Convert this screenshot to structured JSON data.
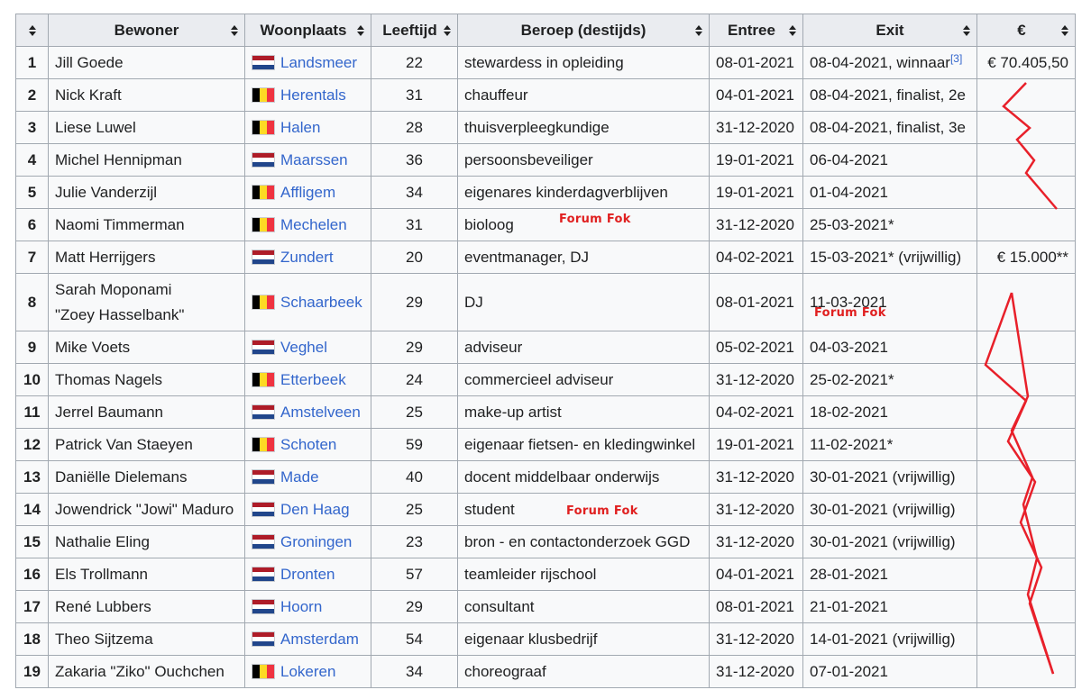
{
  "table": {
    "headers": {
      "num": "",
      "bewoner": "Bewoner",
      "woonplaats": "Woonplaats",
      "leeftijd": "Leeftijd",
      "beroep": "Beroep (destijds)",
      "entree": "Entree",
      "exit": "Exit",
      "prize": "€"
    },
    "rows": [
      {
        "num": "1",
        "name": "Jill Goede",
        "flag": "nl",
        "city": "Landsmeer",
        "age": "22",
        "job": "stewardess in opleiding",
        "entree": "08-01-2021",
        "exit": "08-04-2021, winnaar",
        "ref": "[3]",
        "prize": "€ 70.405,50"
      },
      {
        "num": "2",
        "name": "Nick Kraft",
        "flag": "be",
        "city": "Herentals",
        "age": "31",
        "job": "chauffeur",
        "entree": "04-01-2021",
        "exit": "08-04-2021, finalist, 2e",
        "prize": ""
      },
      {
        "num": "3",
        "name": "Liese Luwel",
        "flag": "be",
        "city": "Halen",
        "age": "28",
        "job": "thuisverpleegkundige",
        "entree": "31-12-2020",
        "exit": "08-04-2021, finalist, 3e",
        "prize": ""
      },
      {
        "num": "4",
        "name": "Michel Hennipman",
        "flag": "nl",
        "city": "Maarssen",
        "age": "36",
        "job": "persoonsbeveiliger",
        "entree": "19-01-2021",
        "exit": "06-04-2021",
        "prize": ""
      },
      {
        "num": "5",
        "name": "Julie Vanderzijl",
        "flag": "be",
        "city": "Affligem",
        "age": "34",
        "job": "eigenares kinderdagverblijven",
        "entree": "19-01-2021",
        "exit": "01-04-2021",
        "prize": ""
      },
      {
        "num": "6",
        "name": "Naomi Timmerman",
        "flag": "be",
        "city": "Mechelen",
        "age": "31",
        "job": "bioloog",
        "entree": "31-12-2020",
        "exit": "25-03-2021*",
        "prize": ""
      },
      {
        "num": "7",
        "name": "Matt Herrijgers",
        "flag": "nl",
        "city": "Zundert",
        "age": "20",
        "job": "eventmanager, DJ",
        "entree": "04-02-2021",
        "exit": "15-03-2021* (vrijwillig)",
        "prize": "€ 15.000**"
      },
      {
        "num": "8",
        "name": "Sarah Moponami",
        "name2": "\"Zoey Hasselbank\"",
        "flag": "be",
        "city": "Schaarbeek",
        "age": "29",
        "job": "DJ",
        "entree": "08-01-2021",
        "exit": "11-03-2021",
        "prize": ""
      },
      {
        "num": "9",
        "name": "Mike Voets",
        "flag": "nl",
        "city": "Veghel",
        "age": "29",
        "job": "adviseur",
        "entree": "05-02-2021",
        "exit": "04-03-2021",
        "prize": ""
      },
      {
        "num": "10",
        "name": "Thomas Nagels",
        "flag": "be",
        "city": "Etterbeek",
        "age": "24",
        "job": "commercieel adviseur",
        "entree": "31-12-2020",
        "exit": "25-02-2021*",
        "prize": ""
      },
      {
        "num": "11",
        "name": "Jerrel Baumann",
        "flag": "nl",
        "city": "Amstelveen",
        "age": "25",
        "job": "make-up artist",
        "entree": "04-02-2021",
        "exit": "18-02-2021",
        "prize": ""
      },
      {
        "num": "12",
        "name": "Patrick Van Staeyen",
        "flag": "be",
        "city": "Schoten",
        "age": "59",
        "job": "eigenaar fietsen- en kledingwinkel",
        "entree": "19-01-2021",
        "exit": "11-02-2021*",
        "prize": ""
      },
      {
        "num": "13",
        "name": "Daniëlle Dielemans",
        "flag": "nl",
        "city": "Made",
        "age": "40",
        "job": "docent middelbaar onderwijs",
        "entree": "31-12-2020",
        "exit": "30-01-2021 (vrijwillig)",
        "prize": ""
      },
      {
        "num": "14",
        "name": "Jowendrick \"Jowi\" Maduro",
        "flag": "nl",
        "city": "Den Haag",
        "age": "25",
        "job": "student",
        "entree": "31-12-2020",
        "exit": "30-01-2021 (vrijwillig)",
        "prize": ""
      },
      {
        "num": "15",
        "name": "Nathalie Eling",
        "flag": "nl",
        "city": "Groningen",
        "age": "23",
        "job": "bron - en contactonderzoek GGD",
        "entree": "31-12-2020",
        "exit": "30-01-2021 (vrijwillig)",
        "prize": ""
      },
      {
        "num": "16",
        "name": "Els Trollmann",
        "flag": "nl",
        "city": "Dronten",
        "age": "57",
        "job": "teamleider rijschool",
        "entree": "04-01-2021",
        "exit": "28-01-2021",
        "prize": ""
      },
      {
        "num": "17",
        "name": "René Lubbers",
        "flag": "nl",
        "city": "Hoorn",
        "age": "29",
        "job": "consultant",
        "entree": "08-01-2021",
        "exit": "21-01-2021",
        "prize": ""
      },
      {
        "num": "18",
        "name": "Theo Sijtzema",
        "flag": "nl",
        "city": "Amsterdam",
        "age": "54",
        "job": "eigenaar klusbedrijf",
        "entree": "31-12-2020",
        "exit": "14-01-2021 (vrijwillig)",
        "prize": ""
      },
      {
        "num": "19",
        "name": "Zakaria \"Ziko\" Ouchchen",
        "flag": "be",
        "city": "Lokeren",
        "age": "34",
        "job": "choreograaf",
        "entree": "31-12-2020",
        "exit": "07-01-2021",
        "prize": ""
      }
    ]
  },
  "watermarks": [
    "Forum Fok",
    "Forum Fok",
    "Forum Fok"
  ],
  "colors": {
    "link": "#3366cc",
    "header_bg": "#eaecf0",
    "cell_bg": "#f8f9fa",
    "border": "#a2a9b1",
    "annotation": "#e02020"
  }
}
